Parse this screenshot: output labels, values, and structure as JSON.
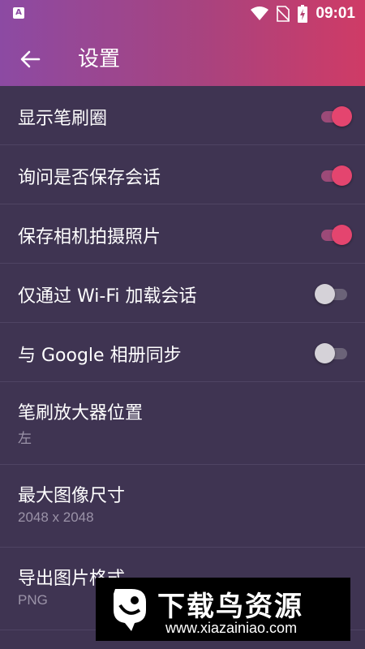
{
  "status_bar": {
    "app_badge": "A",
    "time": "09:01",
    "icons": [
      "wifi-icon",
      "no-sim-icon",
      "battery-charging-icon"
    ]
  },
  "app_bar": {
    "back_icon": "arrow-left-icon",
    "title": "设置"
  },
  "settings": [
    {
      "label": "显示笔刷圈",
      "toggle": true
    },
    {
      "label": "询问是否保存会话",
      "toggle": true
    },
    {
      "label": "保存相机拍摄照片",
      "toggle": true
    },
    {
      "label": "仅通过 Wi-Fi 加载会话",
      "toggle": false
    },
    {
      "label": "与 Google 相册同步",
      "toggle": false
    },
    {
      "label": "笔刷放大器位置",
      "value": "左"
    },
    {
      "label": "最大图像尺寸",
      "value": "2048 x 2048"
    },
    {
      "label": "导出图片格式",
      "value": "PNG"
    }
  ],
  "watermark": {
    "title": "下载鸟资源",
    "url": "www.xiazainiao.com"
  },
  "colors": {
    "accent": "#e4456f",
    "background": "#3f3452",
    "header_start": "#8c4aa3",
    "header_end": "#cf3b66"
  }
}
